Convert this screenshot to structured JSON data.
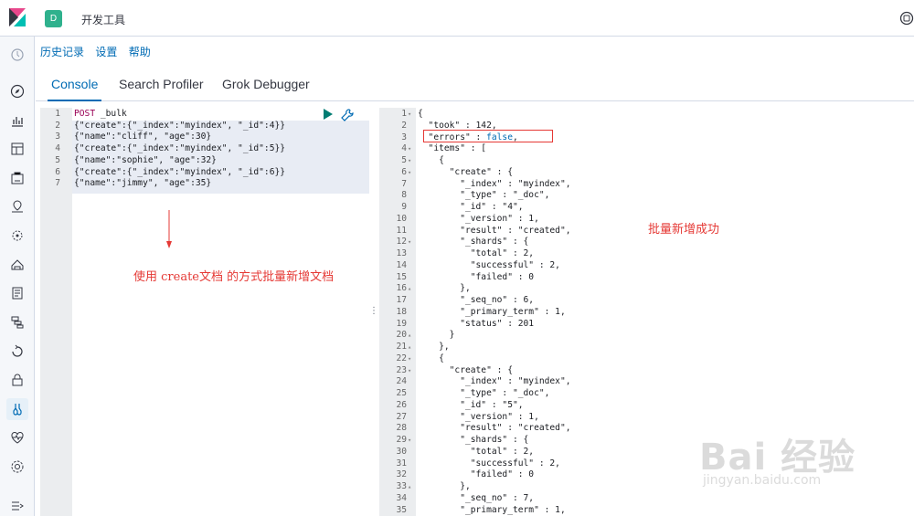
{
  "header": {
    "space_initial": "D",
    "app_title": "开发工具"
  },
  "menu": {
    "history": "历史记录",
    "settings": "设置",
    "help": "帮助"
  },
  "tabs": [
    "Console",
    "Search Profiler",
    "Grok Debugger"
  ],
  "request": {
    "lines": [
      {
        "n": "1",
        "parts": [
          [
            "POST",
            "kw-method"
          ],
          [
            " _bulk",
            "kw-str"
          ]
        ]
      },
      {
        "n": "2",
        "parts": [
          [
            "{\"create\":{\"_index\":\"myindex\", \"_id\":4}}",
            "kw-str"
          ]
        ]
      },
      {
        "n": "3",
        "parts": [
          [
            "{\"name\":\"cliff\", \"age\":30}",
            "kw-str"
          ]
        ]
      },
      {
        "n": "4",
        "parts": [
          [
            "{\"create\":{\"_index\":\"myindex\", \"_id\":5}}",
            "kw-str"
          ]
        ]
      },
      {
        "n": "5",
        "parts": [
          [
            "{\"name\":\"sophie\", \"age\":32}",
            "kw-str"
          ]
        ]
      },
      {
        "n": "6",
        "parts": [
          [
            "{\"create\":{\"_index\":\"myindex\", \"_id\":6}}",
            "kw-str"
          ]
        ]
      },
      {
        "n": "7",
        "parts": [
          [
            "{\"name\":\"jimmy\", \"age\":35}",
            "kw-str"
          ]
        ]
      }
    ]
  },
  "response": {
    "lines": [
      {
        "n": "1",
        "f": "▾",
        "t": "{"
      },
      {
        "n": "2",
        "f": "",
        "t": "  \"took\" : 142,"
      },
      {
        "n": "3",
        "f": "",
        "t": "  \"errors\" : false,"
      },
      {
        "n": "4",
        "f": "▾",
        "t": "  \"items\" : ["
      },
      {
        "n": "5",
        "f": "▾",
        "t": "    {"
      },
      {
        "n": "6",
        "f": "▾",
        "t": "      \"create\" : {"
      },
      {
        "n": "7",
        "f": "",
        "t": "        \"_index\" : \"myindex\","
      },
      {
        "n": "8",
        "f": "",
        "t": "        \"_type\" : \"_doc\","
      },
      {
        "n": "9",
        "f": "",
        "t": "        \"_id\" : \"4\","
      },
      {
        "n": "10",
        "f": "",
        "t": "        \"_version\" : 1,"
      },
      {
        "n": "11",
        "f": "",
        "t": "        \"result\" : \"created\","
      },
      {
        "n": "12",
        "f": "▾",
        "t": "        \"_shards\" : {"
      },
      {
        "n": "13",
        "f": "",
        "t": "          \"total\" : 2,"
      },
      {
        "n": "14",
        "f": "",
        "t": "          \"successful\" : 2,"
      },
      {
        "n": "15",
        "f": "",
        "t": "          \"failed\" : 0"
      },
      {
        "n": "16",
        "f": "▴",
        "t": "        },"
      },
      {
        "n": "17",
        "f": "",
        "t": "        \"_seq_no\" : 6,"
      },
      {
        "n": "18",
        "f": "",
        "t": "        \"_primary_term\" : 1,"
      },
      {
        "n": "19",
        "f": "",
        "t": "        \"status\" : 201"
      },
      {
        "n": "20",
        "f": "▴",
        "t": "      }"
      },
      {
        "n": "21",
        "f": "▴",
        "t": "    },"
      },
      {
        "n": "22",
        "f": "▾",
        "t": "    {"
      },
      {
        "n": "23",
        "f": "▾",
        "t": "      \"create\" : {"
      },
      {
        "n": "24",
        "f": "",
        "t": "        \"_index\" : \"myindex\","
      },
      {
        "n": "25",
        "f": "",
        "t": "        \"_type\" : \"_doc\","
      },
      {
        "n": "26",
        "f": "",
        "t": "        \"_id\" : \"5\","
      },
      {
        "n": "27",
        "f": "",
        "t": "        \"_version\" : 1,"
      },
      {
        "n": "28",
        "f": "",
        "t": "        \"result\" : \"created\","
      },
      {
        "n": "29",
        "f": "▾",
        "t": "        \"_shards\" : {"
      },
      {
        "n": "30",
        "f": "",
        "t": "          \"total\" : 2,"
      },
      {
        "n": "31",
        "f": "",
        "t": "          \"successful\" : 2,"
      },
      {
        "n": "32",
        "f": "",
        "t": "          \"failed\" : 0"
      },
      {
        "n": "33",
        "f": "▴",
        "t": "        },"
      },
      {
        "n": "34",
        "f": "",
        "t": "        \"_seq_no\" : 7,"
      },
      {
        "n": "35",
        "f": "",
        "t": "        \"_primary_term\" : 1,"
      }
    ]
  },
  "annotations": {
    "left": "使用 create文档 的方式批量新增文档",
    "right": "批量新增成功"
  },
  "watermark": {
    "brand": "Bai 经验",
    "url": "jingyan.baidu.com"
  },
  "nav_icons": [
    "clock-icon",
    "compass-icon",
    "visualize-icon",
    "dashboard-icon",
    "canvas-icon",
    "maps-icon",
    "ml-icon",
    "infrastructure-icon",
    "logs-icon",
    "apm-icon",
    "uptime-icon",
    "security-icon",
    "dev-tools-icon",
    "monitoring-icon",
    "management-icon",
    "collapse-icon"
  ],
  "colors": {
    "accent": "#006bb4",
    "annotation": "#e53935",
    "badge": "#2fb18d"
  }
}
